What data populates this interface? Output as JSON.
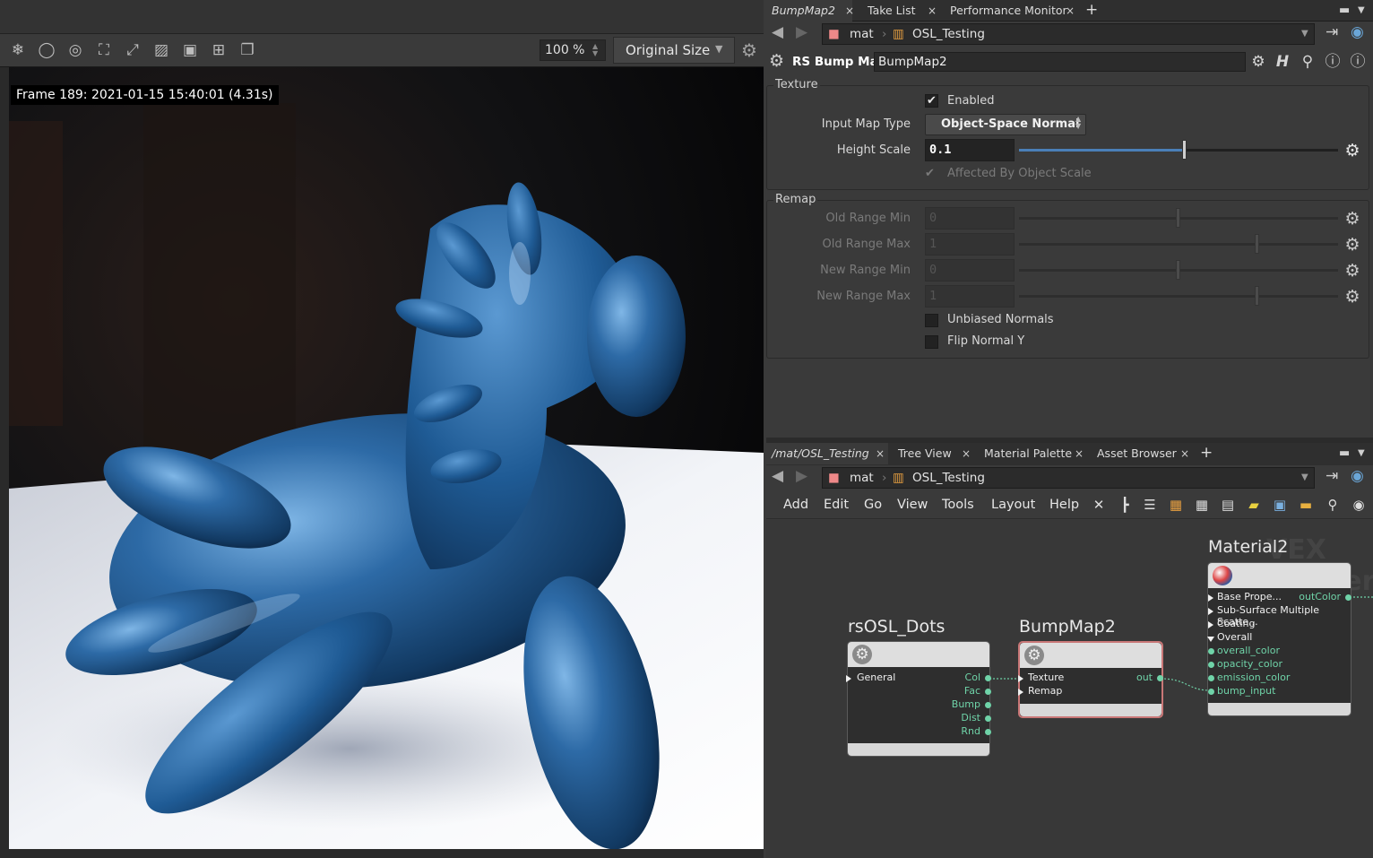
{
  "render_view": {
    "zoom": "100 %",
    "size_mode": "Original Size",
    "frame_info": "Frame  189:  2021-01-15  15:40:01  (4.31s)"
  },
  "top_pane": {
    "tabs": [
      {
        "label": "BumpMap2",
        "active": true
      },
      {
        "label": "Take List",
        "active": false
      },
      {
        "label": "Performance Monitor",
        "active": false
      }
    ],
    "path": [
      "mat",
      "OSL_Testing"
    ],
    "node_type": "RS Bump Map",
    "node_name": "BumpMap2",
    "texture_folder": {
      "label": "Texture",
      "enabled_label": "Enabled",
      "enabled": true,
      "input_map_type_label": "Input Map Type",
      "input_map_type": "Object-Space Normal",
      "height_scale_label": "Height Scale",
      "height_scale": "0.1",
      "height_scale_slider": 0.5,
      "affected_label": "Affected By Object Scale",
      "affected": true
    },
    "remap_folder": {
      "label": "Remap",
      "params": [
        {
          "label": "Old Range Min",
          "value": "0",
          "slider": 0.5
        },
        {
          "label": "Old Range Max",
          "value": "1",
          "slider": 0.75
        },
        {
          "label": "New Range Min",
          "value": "0",
          "slider": 0.5
        },
        {
          "label": "New Range Max",
          "value": "1",
          "slider": 0.75
        }
      ],
      "unbiased_label": "Unbiased Normals",
      "flip_label": "Flip Normal Y"
    }
  },
  "bottom_pane": {
    "tabs": [
      {
        "label": "/mat/OSL_Testing",
        "active": true
      },
      {
        "label": "Tree View",
        "active": false
      },
      {
        "label": "Material Palette",
        "active": false
      },
      {
        "label": "Asset Browser",
        "active": false
      }
    ],
    "path": [
      "mat",
      "OSL_Testing"
    ],
    "menu": [
      "Add",
      "Edit",
      "Go",
      "View",
      "Tools",
      "Layout",
      "Help"
    ],
    "watermark": "VEX Builder",
    "nodes": {
      "dots": {
        "title": "rsOSL_Dots",
        "inputs": [
          "General"
        ],
        "outputs": [
          "Col",
          "Fac",
          "Bump",
          "Dist",
          "Rnd"
        ]
      },
      "bump": {
        "title": "BumpMap2",
        "inputs": [
          "Texture",
          "Remap"
        ],
        "outputs": [
          "out"
        ]
      },
      "material": {
        "title": "Material2",
        "groups": [
          "Base Prope...",
          "Sub-Surface Multiple Scatte...",
          "Coating",
          "Overall"
        ],
        "inputs": [
          "overall_color",
          "opacity_color",
          "emission_color",
          "bump_input"
        ],
        "outputs": [
          "outColor"
        ]
      }
    }
  },
  "colors": {
    "accent_wire": "#6fd3a8",
    "slider_fill": "#4a7fb8",
    "selected_node_border": "#c97777"
  }
}
